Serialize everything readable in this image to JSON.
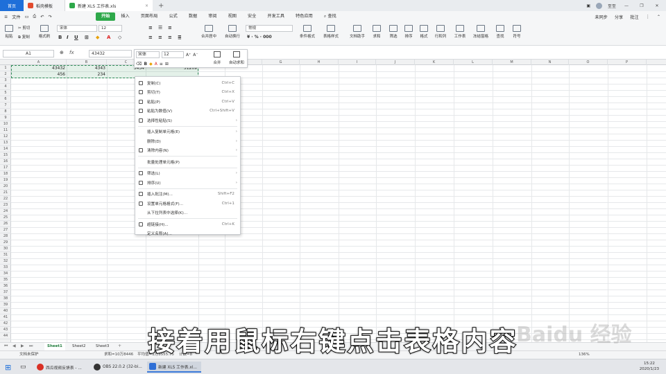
{
  "titlebar": {
    "tabs": [
      {
        "label": "首页"
      },
      {
        "label": "稻壳模板"
      },
      {
        "label": "新建 XLS 工作表.xls"
      }
    ],
    "user": "至至"
  },
  "menu": {
    "file": "文件",
    "items": [
      "开始",
      "插入",
      "页面布局",
      "公式",
      "数据",
      "审阅",
      "视图",
      "安全",
      "开发工具",
      "特色应用"
    ],
    "search": "查找",
    "right": [
      "未同步",
      "分享",
      "批注"
    ]
  },
  "ribbon": {
    "paste": "粘贴",
    "cut": "剪切",
    "copy": "复制",
    "format_painter": "格式刷",
    "font": "宋体",
    "size": "12",
    "merge": "合并居中",
    "wrap": "自动换行",
    "number_format": "常规",
    "conditional": "条件格式",
    "table_style": "表格样式",
    "doc_helper": "文档助手",
    "sum": "求和",
    "filter": "筛选",
    "sort": "排序",
    "format": "格式",
    "rows_cols": "行和列",
    "worksheet": "工作表",
    "freeze": "冻结窗格",
    "find": "查找",
    "symbol": "符号"
  },
  "formula_bar": {
    "name_box": "A1",
    "fx": "fx",
    "value": "43432"
  },
  "mini_toolbar": {
    "font": "宋体",
    "size": "12",
    "merge": "合并",
    "autosum": "自动求和"
  },
  "columns": [
    "A",
    "B",
    "C",
    "D",
    "E",
    "F",
    "G",
    "H",
    "I",
    "J",
    "K",
    "L",
    "M",
    "N",
    "O",
    "P"
  ],
  "cells": {
    "A1": "43432",
    "B1": "4343",
    "C1": "3434",
    "D1": "51209",
    "A2": "456",
    "B2": "234"
  },
  "context_menu": [
    {
      "icon": "copy-icon",
      "label": "复制(C)",
      "shortcut": "Ctrl+C"
    },
    {
      "icon": "cut-icon",
      "label": "剪切(T)",
      "shortcut": "Ctrl+X"
    },
    {
      "icon": "paste-icon",
      "label": "粘贴(P)",
      "shortcut": "Ctrl+V"
    },
    {
      "icon": "paste-value-icon",
      "label": "粘贴为数值(V)",
      "shortcut": "Ctrl+Shift+V"
    },
    {
      "icon": "paste-special-icon",
      "label": "选择性粘贴(S)",
      "shortcut": "",
      "submenu": true
    },
    {
      "sep": true
    },
    {
      "icon": "",
      "label": "插入复制单元格(E)",
      "shortcut": "",
      "submenu": true
    },
    {
      "icon": "",
      "label": "删除(D)",
      "shortcut": "",
      "submenu": true
    },
    {
      "icon": "clear-icon",
      "label": "清除内容(N)",
      "shortcut": "",
      "submenu": true
    },
    {
      "sep": true
    },
    {
      "icon": "",
      "label": "批量处理单元格(P)",
      "shortcut": ""
    },
    {
      "sep": true
    },
    {
      "icon": "filter-icon",
      "label": "筛选(L)",
      "shortcut": "",
      "submenu": true
    },
    {
      "icon": "sort-icon",
      "label": "排序(U)",
      "shortcut": "",
      "submenu": true
    },
    {
      "sep": true
    },
    {
      "icon": "comment-icon",
      "label": "插入批注(M)...",
      "shortcut": "Shift+F2"
    },
    {
      "icon": "format-cells-icon",
      "label": "设置单元格格式(F)...",
      "shortcut": "Ctrl+1"
    },
    {
      "icon": "",
      "label": "从下拉列表中选择(K)...",
      "shortcut": ""
    },
    {
      "sep": true
    },
    {
      "icon": "link-icon",
      "label": "超链接(H)...",
      "shortcut": "Ctrl+K"
    },
    {
      "icon": "",
      "label": "定义名称(A)...",
      "shortcut": ""
    }
  ],
  "sheets": [
    "Sheet1",
    "Sheet2",
    "Sheet3"
  ],
  "status": {
    "protect": "文档未保护",
    "sum": "求和=10万8446",
    "avg": "平均值=1万3555.75",
    "count": "计数=8",
    "zoom": "136%"
  },
  "taskbar": [
    {
      "label": "西瓜视频反馈表 - ..."
    },
    {
      "label": "OBS 22.0.2 (32-bi..."
    },
    {
      "label": "新建 XLS 工作表.xl..."
    }
  ],
  "clock": {
    "time": "15:22",
    "date": "2020/1/23"
  },
  "subtitle": "接着用鼠标右键点击表格内容",
  "watermark": "Baidu 经验",
  "colors": {
    "accent": "#2ea84a",
    "brand_blue": "#1e6fd9",
    "selection": "#2e8b57"
  }
}
